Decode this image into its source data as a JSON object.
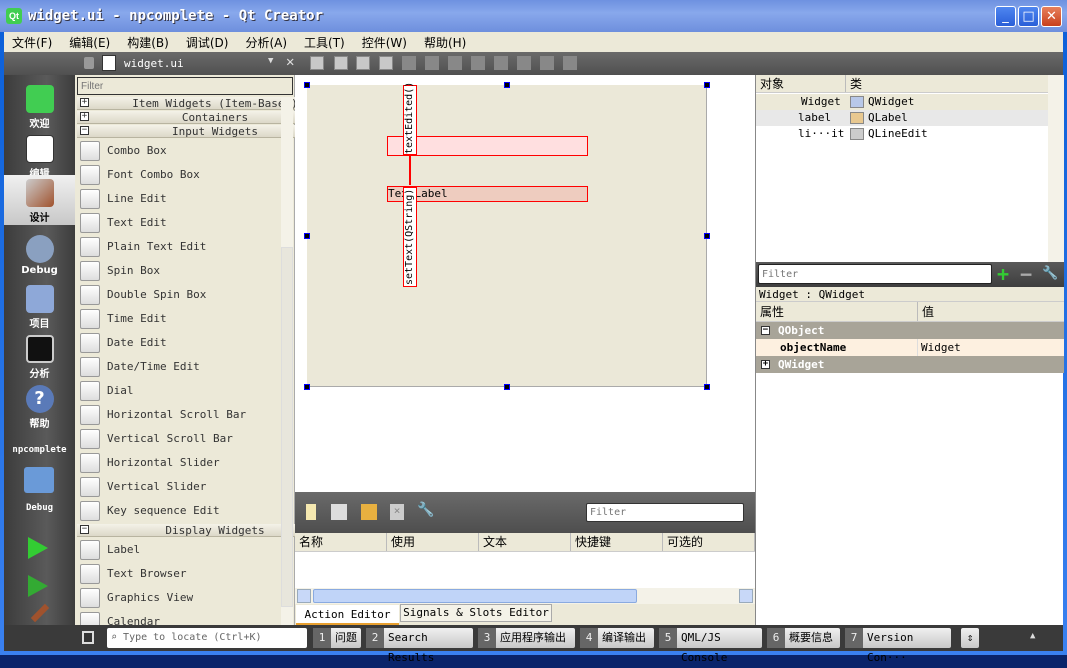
{
  "window": {
    "title": "widget.ui - npcomplete - Qt Creator",
    "logo": "Qt",
    "controls": [
      "minimize",
      "maximize",
      "close"
    ]
  },
  "menu": [
    "文件(F)",
    "编辑(E)",
    "构建(B)",
    "调试(D)",
    "分析(A)",
    "工具(T)",
    "控件(W)",
    "帮助(H)"
  ],
  "editor_toolbar": {
    "file": "widget.ui"
  },
  "modes": [
    {
      "label": "欢迎",
      "icon": "qt-logo-icon"
    },
    {
      "label": "编辑",
      "icon": "edit-document-icon"
    },
    {
      "label": "设计",
      "icon": "design-brush-icon",
      "active": true
    },
    {
      "label": "Debug",
      "icon": "bug-icon"
    },
    {
      "label": "项目",
      "icon": "folder-icon"
    },
    {
      "label": "分析",
      "icon": "analyze-icon"
    },
    {
      "label": "帮助",
      "icon": "help-icon"
    }
  ],
  "target": {
    "project": "npcomplete",
    "config": "Debug"
  },
  "widget_box": {
    "filter_placeholder": "Filter",
    "categories": [
      {
        "label": "Item Widgets (Item-Based)",
        "expanded": false
      },
      {
        "label": "Containers",
        "expanded": false
      },
      {
        "label": "Input Widgets",
        "expanded": true
      },
      {
        "label": "Display Widgets",
        "expanded": true
      }
    ],
    "input_items": [
      "Combo Box",
      "Font Combo Box",
      "Line Edit",
      "Text Edit",
      "Plain Text Edit",
      "Spin Box",
      "Double Spin Box",
      "Time Edit",
      "Date Edit",
      "Date/Time Edit",
      "Dial",
      "Horizontal Scroll Bar",
      "Vertical Scroll Bar",
      "Horizontal Slider",
      "Vertical Slider",
      "Key sequence Edit"
    ],
    "display_items": [
      "Label",
      "Text Browser",
      "Graphics View",
      "Calendar"
    ]
  },
  "form": {
    "label_text": "TextLabel",
    "signal": "textEdited()",
    "slot": "setText(QString)"
  },
  "action_editor": {
    "filter_placeholder": "Filter",
    "columns": [
      "名称",
      "使用",
      "文本",
      "快捷键",
      "可选的"
    ],
    "tabs": [
      "Action Editor",
      "Signals & Slots Editor"
    ]
  },
  "object_inspector": {
    "columns": [
      "对象",
      "类"
    ],
    "rows": [
      {
        "object": "Widget",
        "class": "QWidget"
      },
      {
        "object": "label",
        "class": "QLabel"
      },
      {
        "object": "li···it",
        "class": "QLineEdit"
      }
    ]
  },
  "property_editor": {
    "filter_placeholder": "Filter",
    "context": "Widget : QWidget",
    "columns": [
      "属性",
      "值"
    ],
    "groups": [
      {
        "name": "QObject",
        "expanded": true
      },
      {
        "name": "QWidget",
        "expanded": false
      }
    ],
    "properties": [
      {
        "name": "objectName",
        "value": "Widget"
      }
    ]
  },
  "status": {
    "locate_placeholder": "Type to locate (Ctrl+K)",
    "panes": [
      {
        "n": "1",
        "label": "问题"
      },
      {
        "n": "2",
        "label": "Search Results"
      },
      {
        "n": "3",
        "label": "应用程序输出"
      },
      {
        "n": "4",
        "label": "编译输出"
      },
      {
        "n": "5",
        "label": "QML/JS Console"
      },
      {
        "n": "6",
        "label": "概要信息"
      },
      {
        "n": "7",
        "label": "Version Con···"
      }
    ]
  }
}
